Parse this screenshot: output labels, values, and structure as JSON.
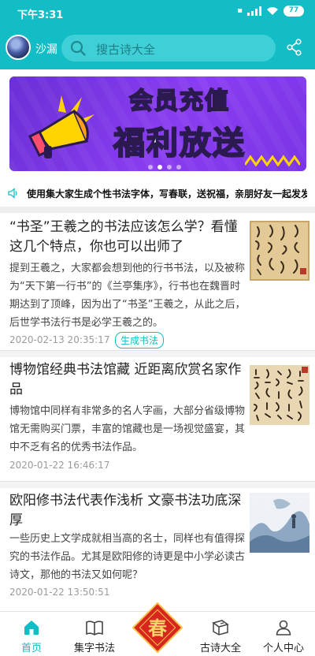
{
  "status_bar": {
    "time": "下午3:31",
    "battery": "77"
  },
  "header": {
    "username": "沙漏",
    "search_placeholder": "搜古诗大全"
  },
  "banner": {
    "line1": "会员充值",
    "line2": "福利放送"
  },
  "notice": {
    "text": "使用集大家生成个性书法字体，写春联，送祝福，亲朋好友一起发发发..."
  },
  "articles": [
    {
      "title": "“书圣”王羲之的书法应该怎么学？看懂这几个特点，你也可以出师了",
      "excerpt": "提到王羲之，大家都会想到他的行书书法，以及被称为“天下第一行书”的《兰亭集序》，行书也在魏晋时期达到了顶峰，因为出了“书圣”王羲之，从此之后，后世学书法行书是必学王羲之的。",
      "date": "2020-02-13 20:35:17",
      "tag": "生成书法"
    },
    {
      "title": "博物馆经典书法馆藏 近距离欣赏名家作品",
      "excerpt": "博物馆中同样有非常多的名人字画，大部分省级博物馆无需购买门票，丰富的馆藏也是一场视觉盛宴，其中不乏有名的优秀书法作品。",
      "date": "2020-01-22 16:46:17"
    },
    {
      "title": "欧阳修书法代表作浅析 文豪书法功底深厚",
      "excerpt": "一些历史上文学成就相当高的名士，同样也有值得探究的书法作品。尤其是欧阳修的诗更是中小学必读古诗文，那他的书法又如何呢？",
      "date": "2020-01-22 13:50:51"
    }
  ],
  "tabbar": {
    "home": "首页",
    "calligraphy": "集字书法",
    "center_badge": "春",
    "poems": "古诗大全",
    "profile": "个人中心"
  },
  "colors": {
    "accent": "#13bdc6",
    "banner": "#7b35e8"
  }
}
